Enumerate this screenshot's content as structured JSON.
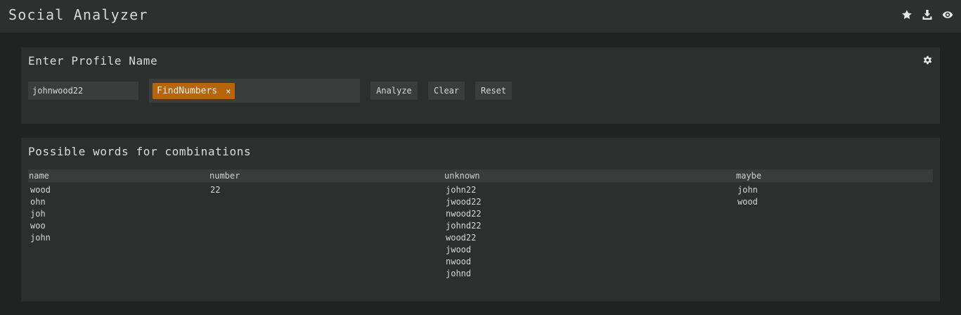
{
  "header": {
    "title": "Social Analyzer",
    "icons": [
      "star-icon",
      "download-icon",
      "eye-icon"
    ]
  },
  "profile_panel": {
    "title": "Enter Profile Name",
    "input_value": "johnwood22",
    "tags": [
      {
        "label": "FindNumbers",
        "remove": "×"
      }
    ],
    "buttons": {
      "analyze": "Analyze",
      "clear": "Clear",
      "reset": "Reset"
    },
    "settings_icon": "gear-icon"
  },
  "words_panel": {
    "title": "Possible words for combinations",
    "columns": [
      "name",
      "number",
      "unknown",
      "maybe"
    ],
    "name": [
      "wood",
      "ohn",
      "joh",
      "woo",
      "john"
    ],
    "number": [
      "22"
    ],
    "unknown": [
      "john22",
      "jwood22",
      "nwood22",
      "johnd22",
      "wood22",
      "jwood",
      "nwood",
      "johnd"
    ],
    "maybe": [
      "john",
      "wood"
    ]
  },
  "colors": {
    "background": "#212222",
    "panel": "#2d2e2e",
    "tag": "#b6660a"
  }
}
